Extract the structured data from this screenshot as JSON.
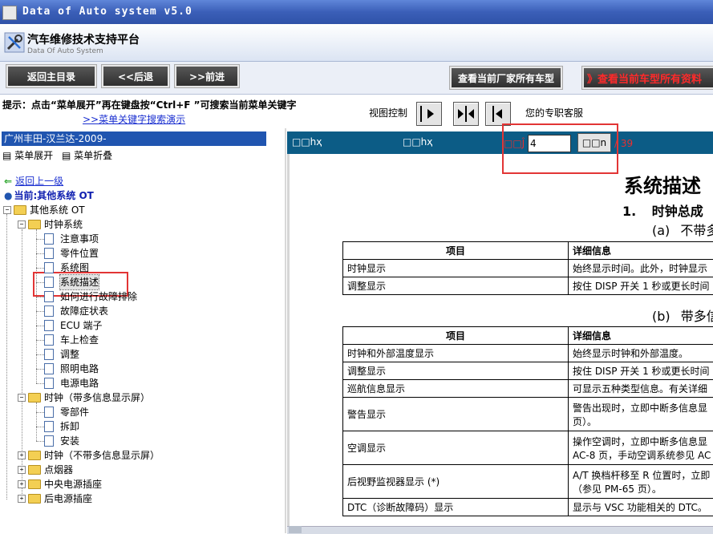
{
  "window": {
    "title": "Data of Auto system v5.0"
  },
  "brand": {
    "title": "汽车维修技术支持平台",
    "subtitle": "Data Of Auto System"
  },
  "nav": {
    "home": "返回主目录",
    "back": "<<后退",
    "forward": ">>前进",
    "all_models_factory": "查看当前厂家所有车型",
    "all_model_docs": "》查看当前车型所有资料"
  },
  "hint": {
    "text": "提示：点击“菜单展开”再在键盘按“Ctrl+F ”可搜索当前菜单关键字",
    "link": ">>菜单关键字搜索演示",
    "view_label": "视图控制",
    "service": "您的专职客服"
  },
  "left": {
    "header": "广州丰田-汉兰达-2009-",
    "expand": "菜单展开",
    "collapse": "菜单折叠",
    "back_link": "返回上一级",
    "current": "当前:其他系统  OT",
    "tree": {
      "root": "其他系统  OT",
      "clock": "时钟系统",
      "clock_items": [
        "注意事项",
        "零件位置",
        "系统图",
        "系统描述",
        "如何进行故障排除",
        "故障症状表",
        "ECU 端子",
        "车上检查",
        "调整",
        "照明电路",
        "电源电路"
      ],
      "clock_multi": "时钟（带多信息显示屏）",
      "clock_multi_items": [
        "零部件",
        "拆卸",
        "安装"
      ],
      "clock_nomulti": "时钟（不带多信息显示屏）",
      "lighter": "点烟器",
      "center_socket": "中央电源插座",
      "rear_socket": "后电源插座"
    }
  },
  "viewer": {
    "bar_left1": "□□hҳ",
    "bar_left2": "□□hҳ",
    "page_label": "□□Ĵ",
    "page_value": "4",
    "go_label": "□□n",
    "page_total": "/ 39",
    "doc": {
      "title": "系统描述",
      "h1_num": "1.",
      "h1": "时钟总成",
      "sub_a_tag": "(a)",
      "sub_a": "不带多",
      "sub_b_tag": "(b)",
      "sub_b": "带多信",
      "col_item": "项目",
      "col_detail": "详细信息",
      "table1": [
        [
          "时钟显示",
          "始终显示时间。此外，时钟显示"
        ],
        [
          "调整显示",
          "按住 DISP 开关 1 秒或更长时间"
        ]
      ],
      "table2": [
        [
          "时钟和外部温度显示",
          "始终显示时钟和外部温度。"
        ],
        [
          "调整显示",
          "按住 DISP 开关 1 秒或更长时间"
        ],
        [
          "巡航信息显示",
          "可显示五种类型信息。有关详细"
        ],
        [
          "警告显示",
          "警告出现时，立即中断多信息显",
          "页）。"
        ],
        [
          "空调显示",
          "操作空调时，立即中断多信息显",
          "AC-8 页，手动空调系统参见 AC"
        ],
        [
          "后视野监视器显示 (*)",
          "A/T 换档杆移至 R 位置时，立即",
          "（参见 PM-65 页）。"
        ],
        [
          "DTC（诊断故障码）显示",
          "显示与 VSC 功能相关的 DTC。"
        ]
      ]
    }
  },
  "colors": {
    "title_bar": "#3b5fb8",
    "left_header": "#2055b0",
    "viewer_bar": "#0c5c86",
    "highlight": "#e23535",
    "hint_link": "#1a2fd0"
  }
}
